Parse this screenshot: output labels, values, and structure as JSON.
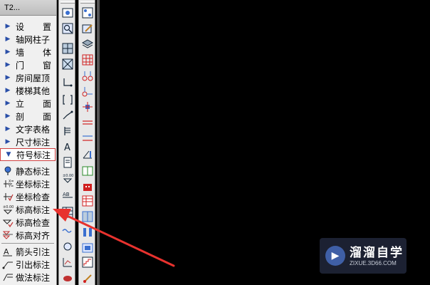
{
  "panel": {
    "title": "T2...",
    "menu": [
      {
        "label": "设 置",
        "chars": [
          "设",
          "置"
        ]
      },
      {
        "label": "轴网柱子",
        "chars": [
          "轴网柱子"
        ]
      },
      {
        "label": "墙 体",
        "chars": [
          "墙",
          "体"
        ]
      },
      {
        "label": "门 窗",
        "chars": [
          "门",
          "窗"
        ]
      },
      {
        "label": "房间屋顶",
        "chars": [
          "房间屋顶"
        ]
      },
      {
        "label": "楼梯其他",
        "chars": [
          "楼梯其他"
        ]
      },
      {
        "label": "立 面",
        "chars": [
          "立",
          "面"
        ]
      },
      {
        "label": "剖 面",
        "chars": [
          "剖",
          "面"
        ]
      },
      {
        "label": "文字表格",
        "chars": [
          "文字表格"
        ]
      },
      {
        "label": "尺寸标注",
        "chars": [
          "尺寸标注"
        ]
      },
      {
        "label": "符号标注",
        "chars": [
          "符号标注"
        ]
      }
    ],
    "submenu": [
      {
        "label": "静态标注",
        "icon": "pin-icon"
      },
      {
        "label": "坐标标注",
        "icon": "coordinate-icon"
      },
      {
        "label": "坐标检查",
        "icon": "coordinate-check-icon"
      },
      {
        "label": "标高标注",
        "icon": "elevation-icon"
      },
      {
        "label": "标高检查",
        "icon": "elevation-check-icon"
      },
      {
        "label": "标高对齐",
        "icon": "elevation-align-icon"
      },
      {
        "label": "箭头引注",
        "icon": "arrow-note-icon"
      },
      {
        "label": "引出标注",
        "icon": "leader-note-icon"
      },
      {
        "label": "做法标注",
        "icon": "method-note-icon"
      }
    ]
  },
  "watermark": {
    "title": "溜溜自学",
    "url": "ZIXUE.3D66.COM"
  },
  "colors": {
    "background": "#000000",
    "panel": "#f0f0f0",
    "annotation_arrow": "#e8322e",
    "highlight_border": "#d04040"
  }
}
